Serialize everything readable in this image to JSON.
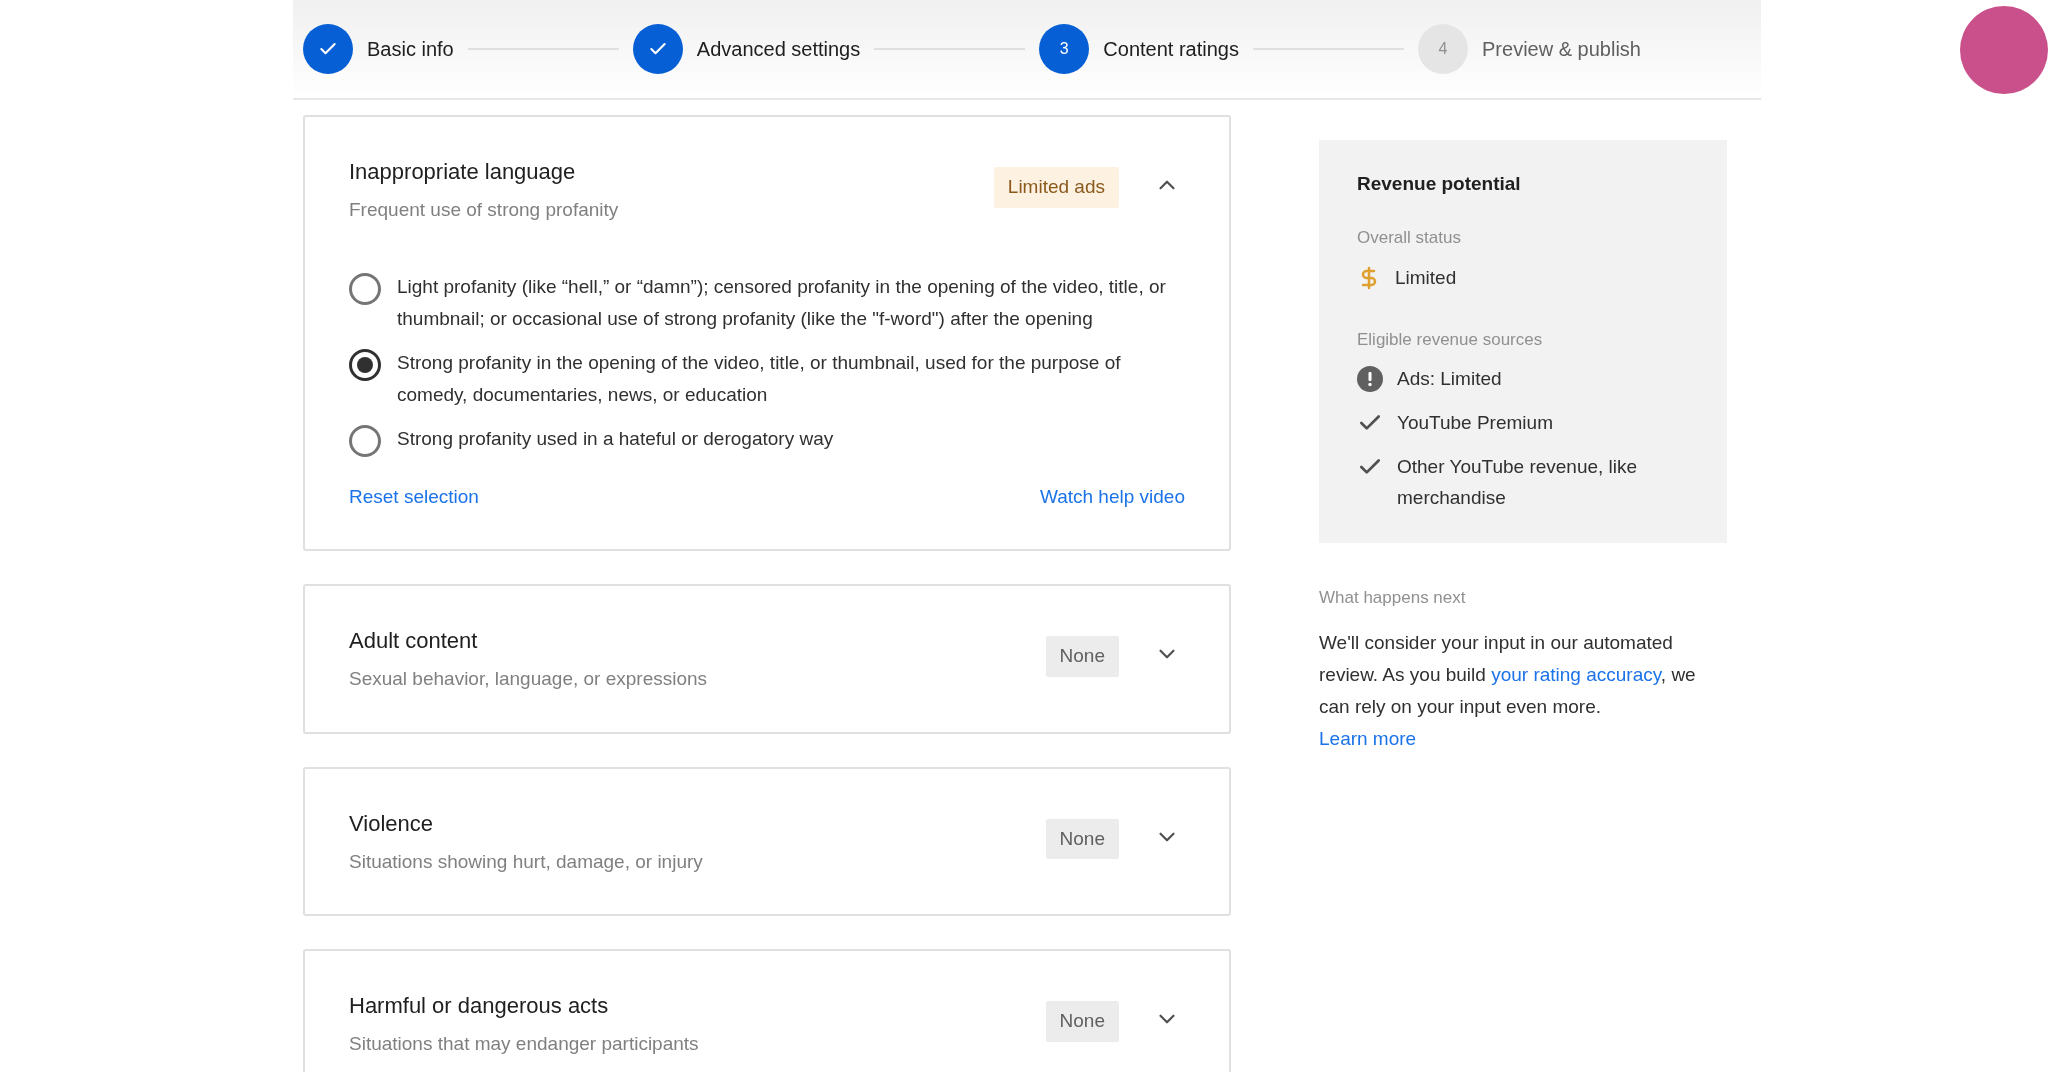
{
  "stepper": [
    {
      "label": "Basic info",
      "kind": "complete"
    },
    {
      "label": "Advanced settings",
      "kind": "complete"
    },
    {
      "label": "Content ratings",
      "kind": "current",
      "number": "3"
    },
    {
      "label": "Preview & publish",
      "kind": "upcoming",
      "number": "4"
    }
  ],
  "categories": [
    {
      "title": "Inappropriate language",
      "subtitle": "Frequent use of strong profanity",
      "badge": {
        "text": "Limited ads",
        "kind": "limited"
      },
      "expanded": true,
      "options": [
        {
          "label": "Light profanity (like “hell,” or “damn”); censored profanity in the opening of the video, title, or thumbnail; or occasional use of strong profanity (like the \"f-word\") after the opening",
          "selected": false
        },
        {
          "label": "Strong profanity in the opening of the video, title, or thumbnail, used for the purpose of comedy, documentaries, news, or education",
          "selected": true
        },
        {
          "label": "Strong profanity used in a hateful or derogatory way",
          "selected": false
        }
      ],
      "reset_link": "Reset selection",
      "help_link": "Watch help video"
    },
    {
      "title": "Adult content",
      "subtitle": "Sexual behavior, language, or expressions",
      "badge": {
        "text": "None",
        "kind": "none"
      },
      "expanded": false
    },
    {
      "title": "Violence",
      "subtitle": "Situations showing hurt, damage, or injury",
      "badge": {
        "text": "None",
        "kind": "none"
      },
      "expanded": false
    },
    {
      "title": "Harmful or dangerous acts",
      "subtitle": "Situations that may endanger participants",
      "badge": {
        "text": "None",
        "kind": "none"
      },
      "expanded": false
    }
  ],
  "revenue_panel": {
    "title": "Revenue potential",
    "overall_label": "Overall status",
    "overall_status": "Limited",
    "sources_label": "Eligible revenue sources",
    "sources": [
      {
        "label": "Ads: Limited",
        "kind": "warning"
      },
      {
        "label": "YouTube Premium",
        "kind": "check"
      },
      {
        "label": "Other YouTube revenue, like merchandise",
        "kind": "check"
      }
    ]
  },
  "next_steps": {
    "heading": "What happens next",
    "text_before": "We'll consider your input in our automated review. As you build ",
    "link": "your rating accuracy",
    "text_after": ", we can rely on your input even more.",
    "learn_more": "Learn more"
  }
}
